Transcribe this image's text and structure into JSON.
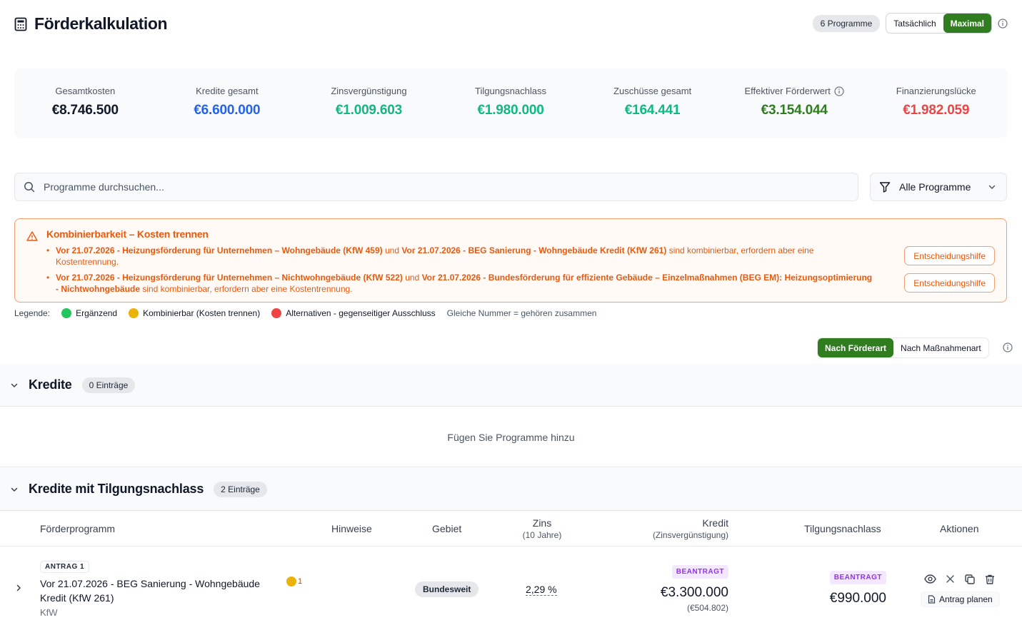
{
  "header": {
    "title": "Förderkalkulation",
    "program_count": "6 Programme",
    "mode_actual": "Tatsächlich",
    "mode_max": "Maximal"
  },
  "summary": [
    {
      "label": "Gesamtkosten",
      "value": "€8.746.500",
      "color": "#111827"
    },
    {
      "label": "Kredite gesamt",
      "value": "€6.600.000",
      "color": "#2563eb"
    },
    {
      "label": "Zinsvergünstigung",
      "value": "€1.009.603",
      "color": "#10b981"
    },
    {
      "label": "Tilgungsnachlass",
      "value": "€1.980.000",
      "color": "#10b981"
    },
    {
      "label": "Zuschüsse gesamt",
      "value": "€164.441",
      "color": "#10b981"
    },
    {
      "label": "Effektiver Förderwert",
      "value": "€3.154.044",
      "color": "#2f7d1e"
    },
    {
      "label": "Finanzierungslücke",
      "value": "€1.982.059",
      "color": "#ef4444"
    }
  ],
  "search": {
    "placeholder": "Programme durchsuchen..."
  },
  "filter": {
    "label": "Alle Programme"
  },
  "warning": {
    "title": "Kombinierbarkeit – Kosten trennen",
    "items": [
      {
        "a": "Vor 21.07.2026 - Heizungsförderung für Unternehmen – Wohngebäude (KfW 459)",
        "conj": " und ",
        "b": "Vor 21.07.2026 - BEG Sanierung - Wohngebäude Kredit (KfW 261)",
        "tail": " sind kombinierbar, erfordern aber eine Kostentrennung."
      },
      {
        "a": "Vor 21.07.2026 - Heizungsförderung für Unternehmen – Nichtwohngebäude (KfW 522)",
        "conj": " und ",
        "b": "Vor 21.07.2026 - Bundesförderung für effiziente Gebäude – Einzelmaßnahmen (BEG EM): Heizungsoptimierung - Nichtwohngebäude",
        "tail": " sind kombinierbar, erfordern aber eine Kostentrennung."
      }
    ],
    "button_label": "Entscheidungshilfe"
  },
  "legend": {
    "label": "Legende:",
    "items": [
      {
        "label": "Ergänzend",
        "color": "#22c55e"
      },
      {
        "label": "Kombinierbar (Kosten trennen)",
        "color": "#eab308"
      },
      {
        "label": "Alternativen - gegenseitiger Ausschluss",
        "color": "#ef4444"
      }
    ],
    "note": "Gleiche Nummer = gehören zusammen"
  },
  "grouping": {
    "by_type": "Nach Förderart",
    "by_measure": "Nach Maßnahmenart"
  },
  "sections": [
    {
      "name": "Kredite",
      "badge": "0 Einträge",
      "empty_text": "Fügen Sie Programme hinzu"
    },
    {
      "name": "Kredite mit Tilgungsnachlass",
      "badge": "2 Einträge"
    }
  ],
  "table": {
    "headers": {
      "program": "Förderprogramm",
      "hints": "Hinweise",
      "area": "Gebiet",
      "rate": "Zins",
      "rate_sub": "(10 Jahre)",
      "credit": "Kredit",
      "credit_sub": "(Zinsvergünstigung)",
      "repayment": "Tilgungsnachlass",
      "actions": "Aktionen"
    },
    "rows": [
      {
        "tag": "ANTRAG 1",
        "name": "Vor 21.07.2026 - BEG Sanierung - Wohngebäude Kredit (KfW 261)",
        "provider": "KfW",
        "hint_count": "1",
        "area": "Bundesweit",
        "rate": "2,29 %",
        "credit_status": "BEANTRAGT",
        "credit": "€3.300.000",
        "credit_sub": "(€504.802)",
        "repayment_status": "BEANTRAGT",
        "repayment": "€990.000",
        "plan_label": "Antrag planen"
      }
    ]
  }
}
